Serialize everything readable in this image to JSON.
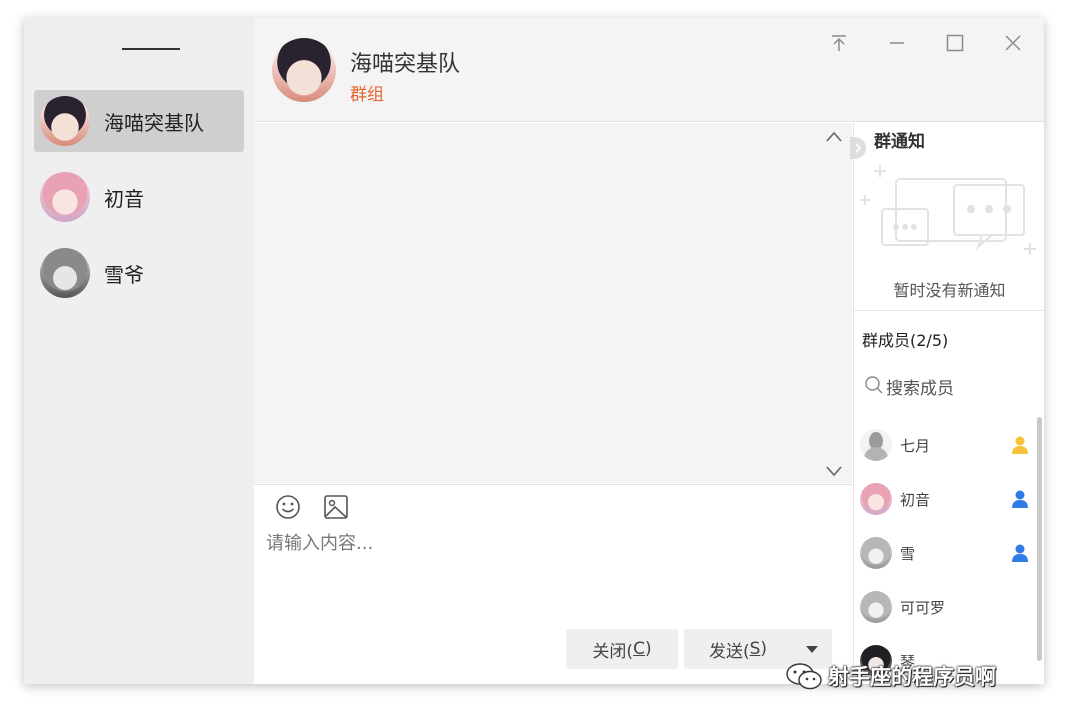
{
  "sidebar": {
    "conversations": [
      {
        "name": "海喵突基队",
        "active": true
      },
      {
        "name": "初音",
        "active": false
      },
      {
        "name": "雪爷",
        "active": false
      }
    ]
  },
  "header": {
    "title": "海喵突基队",
    "subtitle": "群组"
  },
  "input": {
    "placeholder": "请输入内容..."
  },
  "buttons": {
    "close_label": "关闭(",
    "close_key": "C",
    "close_end": ")",
    "send_label": "发送(",
    "send_key": "S",
    "send_end": ")"
  },
  "notice": {
    "title": "群通知",
    "empty_text": "暂时没有新通知"
  },
  "members": {
    "title": "群成员(2/5)",
    "search_placeholder": "搜索成员",
    "list": [
      {
        "name": "七月",
        "role_color": "#f5c23a"
      },
      {
        "name": "初音",
        "role_color": "#2f7be8"
      },
      {
        "name": "雪",
        "role_color": "#2f7be8"
      },
      {
        "name": "可可罗",
        "role_color": ""
      },
      {
        "name": "琴",
        "role_color": ""
      }
    ]
  },
  "watermark": {
    "text": "射手座的程序员啊"
  },
  "colors": {
    "accent_orange": "#e8662d",
    "admin_yellow": "#f5c23a",
    "member_blue": "#2f7be8"
  }
}
